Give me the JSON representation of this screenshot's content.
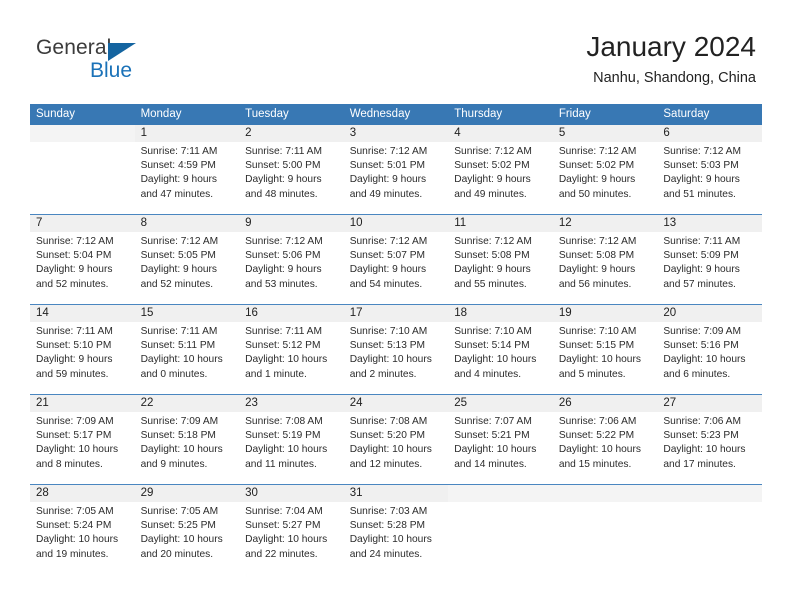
{
  "brand": {
    "name_top": "General",
    "name_bottom": "Blue",
    "accent_color": "#1b72b8",
    "triangle_color": "#1464a0"
  },
  "header": {
    "title": "January 2024",
    "subtitle": "Nanhu, Shandong, China"
  },
  "theme": {
    "header_row_bg": "#3878b4",
    "header_row_text": "#ffffff",
    "daynum_band_bg": "#f4f4f4",
    "week_divider": "#4a86c0",
    "page_bg": "#ffffff"
  },
  "calendar": {
    "day_headers": [
      "Sunday",
      "Monday",
      "Tuesday",
      "Wednesday",
      "Thursday",
      "Friday",
      "Saturday"
    ],
    "weeks": [
      [
        {
          "day": "",
          "sunrise": "",
          "sunset": "",
          "daylight_line1": "",
          "daylight_line2": "",
          "empty": true
        },
        {
          "day": "1",
          "sunrise": "Sunrise: 7:11 AM",
          "sunset": "Sunset: 4:59 PM",
          "daylight_line1": "Daylight: 9 hours",
          "daylight_line2": "and 47 minutes."
        },
        {
          "day": "2",
          "sunrise": "Sunrise: 7:11 AM",
          "sunset": "Sunset: 5:00 PM",
          "daylight_line1": "Daylight: 9 hours",
          "daylight_line2": "and 48 minutes."
        },
        {
          "day": "3",
          "sunrise": "Sunrise: 7:12 AM",
          "sunset": "Sunset: 5:01 PM",
          "daylight_line1": "Daylight: 9 hours",
          "daylight_line2": "and 49 minutes."
        },
        {
          "day": "4",
          "sunrise": "Sunrise: 7:12 AM",
          "sunset": "Sunset: 5:02 PM",
          "daylight_line1": "Daylight: 9 hours",
          "daylight_line2": "and 49 minutes."
        },
        {
          "day": "5",
          "sunrise": "Sunrise: 7:12 AM",
          "sunset": "Sunset: 5:02 PM",
          "daylight_line1": "Daylight: 9 hours",
          "daylight_line2": "and 50 minutes."
        },
        {
          "day": "6",
          "sunrise": "Sunrise: 7:12 AM",
          "sunset": "Sunset: 5:03 PM",
          "daylight_line1": "Daylight: 9 hours",
          "daylight_line2": "and 51 minutes."
        }
      ],
      [
        {
          "day": "7",
          "sunrise": "Sunrise: 7:12 AM",
          "sunset": "Sunset: 5:04 PM",
          "daylight_line1": "Daylight: 9 hours",
          "daylight_line2": "and 52 minutes."
        },
        {
          "day": "8",
          "sunrise": "Sunrise: 7:12 AM",
          "sunset": "Sunset: 5:05 PM",
          "daylight_line1": "Daylight: 9 hours",
          "daylight_line2": "and 52 minutes."
        },
        {
          "day": "9",
          "sunrise": "Sunrise: 7:12 AM",
          "sunset": "Sunset: 5:06 PM",
          "daylight_line1": "Daylight: 9 hours",
          "daylight_line2": "and 53 minutes."
        },
        {
          "day": "10",
          "sunrise": "Sunrise: 7:12 AM",
          "sunset": "Sunset: 5:07 PM",
          "daylight_line1": "Daylight: 9 hours",
          "daylight_line2": "and 54 minutes."
        },
        {
          "day": "11",
          "sunrise": "Sunrise: 7:12 AM",
          "sunset": "Sunset: 5:08 PM",
          "daylight_line1": "Daylight: 9 hours",
          "daylight_line2": "and 55 minutes."
        },
        {
          "day": "12",
          "sunrise": "Sunrise: 7:12 AM",
          "sunset": "Sunset: 5:08 PM",
          "daylight_line1": "Daylight: 9 hours",
          "daylight_line2": "and 56 minutes."
        },
        {
          "day": "13",
          "sunrise": "Sunrise: 7:11 AM",
          "sunset": "Sunset: 5:09 PM",
          "daylight_line1": "Daylight: 9 hours",
          "daylight_line2": "and 57 minutes."
        }
      ],
      [
        {
          "day": "14",
          "sunrise": "Sunrise: 7:11 AM",
          "sunset": "Sunset: 5:10 PM",
          "daylight_line1": "Daylight: 9 hours",
          "daylight_line2": "and 59 minutes."
        },
        {
          "day": "15",
          "sunrise": "Sunrise: 7:11 AM",
          "sunset": "Sunset: 5:11 PM",
          "daylight_line1": "Daylight: 10 hours",
          "daylight_line2": "and 0 minutes."
        },
        {
          "day": "16",
          "sunrise": "Sunrise: 7:11 AM",
          "sunset": "Sunset: 5:12 PM",
          "daylight_line1": "Daylight: 10 hours",
          "daylight_line2": "and 1 minute."
        },
        {
          "day": "17",
          "sunrise": "Sunrise: 7:10 AM",
          "sunset": "Sunset: 5:13 PM",
          "daylight_line1": "Daylight: 10 hours",
          "daylight_line2": "and 2 minutes."
        },
        {
          "day": "18",
          "sunrise": "Sunrise: 7:10 AM",
          "sunset": "Sunset: 5:14 PM",
          "daylight_line1": "Daylight: 10 hours",
          "daylight_line2": "and 4 minutes."
        },
        {
          "day": "19",
          "sunrise": "Sunrise: 7:10 AM",
          "sunset": "Sunset: 5:15 PM",
          "daylight_line1": "Daylight: 10 hours",
          "daylight_line2": "and 5 minutes."
        },
        {
          "day": "20",
          "sunrise": "Sunrise: 7:09 AM",
          "sunset": "Sunset: 5:16 PM",
          "daylight_line1": "Daylight: 10 hours",
          "daylight_line2": "and 6 minutes."
        }
      ],
      [
        {
          "day": "21",
          "sunrise": "Sunrise: 7:09 AM",
          "sunset": "Sunset: 5:17 PM",
          "daylight_line1": "Daylight: 10 hours",
          "daylight_line2": "and 8 minutes."
        },
        {
          "day": "22",
          "sunrise": "Sunrise: 7:09 AM",
          "sunset": "Sunset: 5:18 PM",
          "daylight_line1": "Daylight: 10 hours",
          "daylight_line2": "and 9 minutes."
        },
        {
          "day": "23",
          "sunrise": "Sunrise: 7:08 AM",
          "sunset": "Sunset: 5:19 PM",
          "daylight_line1": "Daylight: 10 hours",
          "daylight_line2": "and 11 minutes."
        },
        {
          "day": "24",
          "sunrise": "Sunrise: 7:08 AM",
          "sunset": "Sunset: 5:20 PM",
          "daylight_line1": "Daylight: 10 hours",
          "daylight_line2": "and 12 minutes."
        },
        {
          "day": "25",
          "sunrise": "Sunrise: 7:07 AM",
          "sunset": "Sunset: 5:21 PM",
          "daylight_line1": "Daylight: 10 hours",
          "daylight_line2": "and 14 minutes."
        },
        {
          "day": "26",
          "sunrise": "Sunrise: 7:06 AM",
          "sunset": "Sunset: 5:22 PM",
          "daylight_line1": "Daylight: 10 hours",
          "daylight_line2": "and 15 minutes."
        },
        {
          "day": "27",
          "sunrise": "Sunrise: 7:06 AM",
          "sunset": "Sunset: 5:23 PM",
          "daylight_line1": "Daylight: 10 hours",
          "daylight_line2": "and 17 minutes."
        }
      ],
      [
        {
          "day": "28",
          "sunrise": "Sunrise: 7:05 AM",
          "sunset": "Sunset: 5:24 PM",
          "daylight_line1": "Daylight: 10 hours",
          "daylight_line2": "and 19 minutes."
        },
        {
          "day": "29",
          "sunrise": "Sunrise: 7:05 AM",
          "sunset": "Sunset: 5:25 PM",
          "daylight_line1": "Daylight: 10 hours",
          "daylight_line2": "and 20 minutes."
        },
        {
          "day": "30",
          "sunrise": "Sunrise: 7:04 AM",
          "sunset": "Sunset: 5:27 PM",
          "daylight_line1": "Daylight: 10 hours",
          "daylight_line2": "and 22 minutes."
        },
        {
          "day": "31",
          "sunrise": "Sunrise: 7:03 AM",
          "sunset": "Sunset: 5:28 PM",
          "daylight_line1": "Daylight: 10 hours",
          "daylight_line2": "and 24 minutes."
        },
        {
          "day": "",
          "sunrise": "",
          "sunset": "",
          "daylight_line1": "",
          "daylight_line2": "",
          "empty": true
        },
        {
          "day": "",
          "sunrise": "",
          "sunset": "",
          "daylight_line1": "",
          "daylight_line2": "",
          "empty": true
        },
        {
          "day": "",
          "sunrise": "",
          "sunset": "",
          "daylight_line1": "",
          "daylight_line2": "",
          "empty": true
        }
      ]
    ]
  }
}
